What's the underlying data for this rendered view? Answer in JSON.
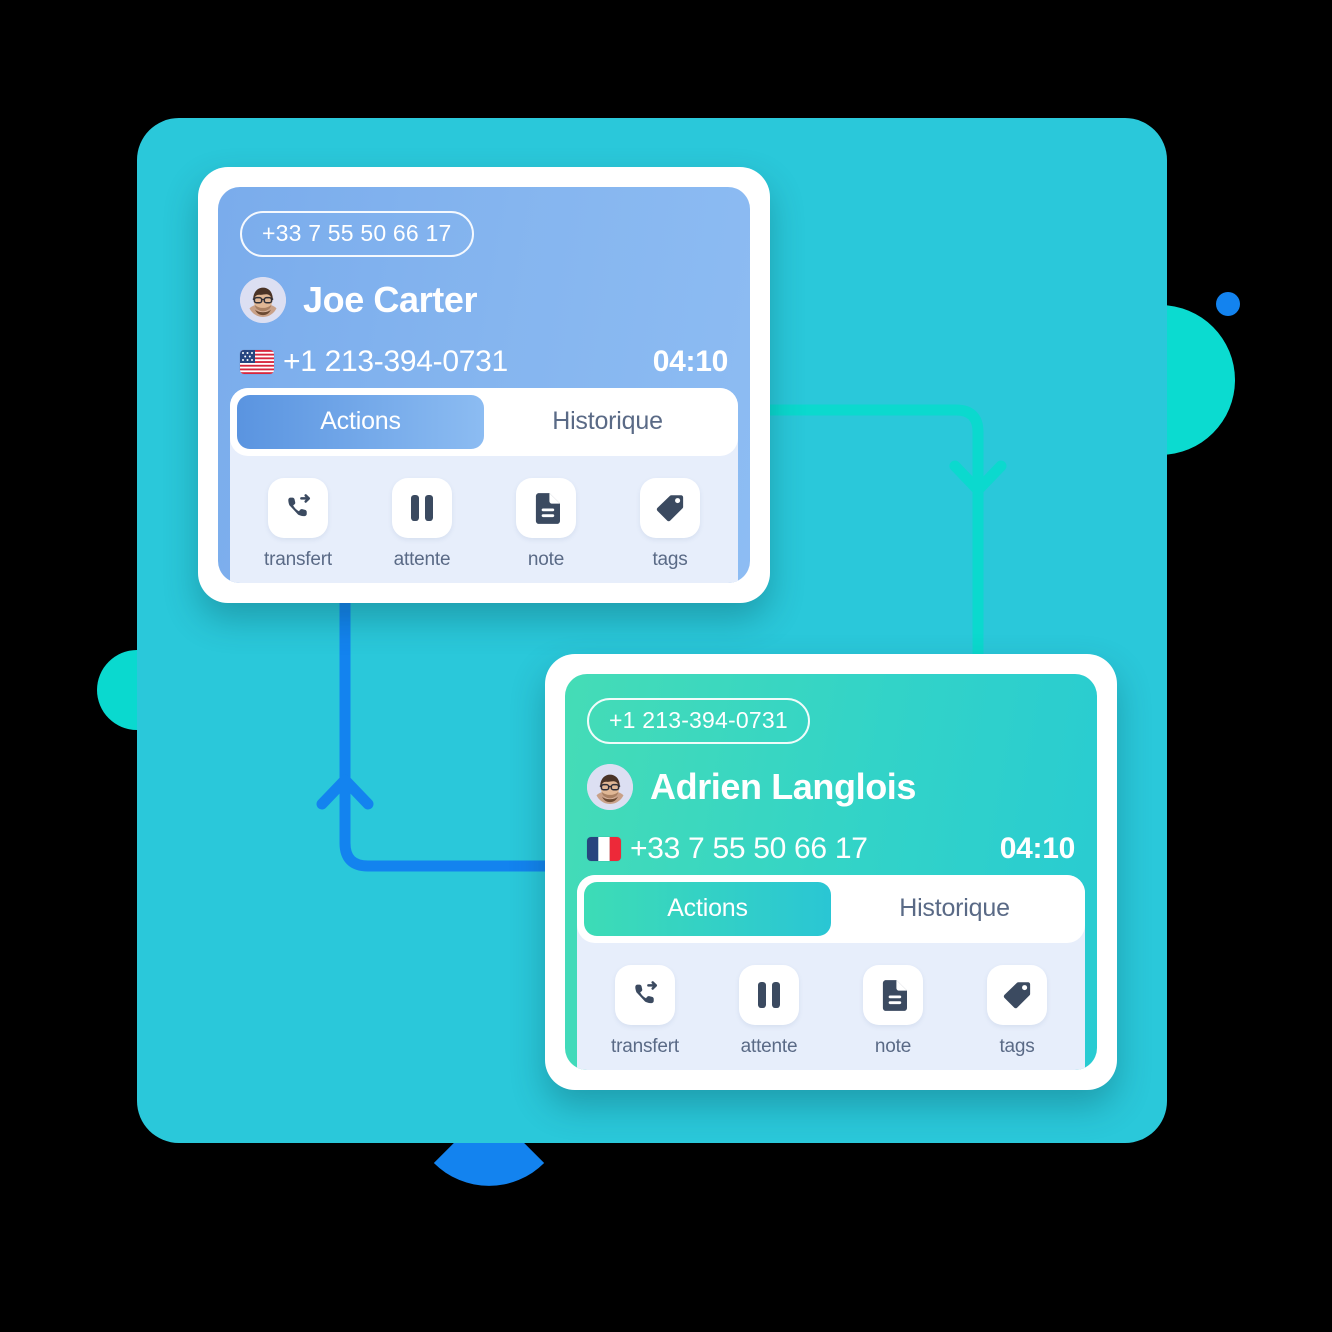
{
  "theme": {
    "backdrop_color": "#2AC8DA",
    "card1_accent": "#85B5EF",
    "card2_accent": "#32D3C8",
    "connector_blue": "#1383EF",
    "connector_teal": "#0BD9CE",
    "panel_bg": "#E7EEFB",
    "icon_color": "#3B4A60",
    "label_color": "#5A6A86"
  },
  "decorations": [
    {
      "name": "circle-teal-right",
      "color": "#0BDBD0"
    },
    {
      "name": "circle-blue-small",
      "color": "#1383EF"
    },
    {
      "name": "circle-teal-left",
      "color": "#0AD9CF"
    },
    {
      "name": "leaf-blue",
      "color": "#1383EF"
    }
  ],
  "connectors": [
    {
      "name": "teal-arrow-down",
      "from": "card-joe-right",
      "to": "card-adrien-top",
      "color": "#0BD9CE",
      "direction": "down"
    },
    {
      "name": "blue-arrow-up",
      "from": "card-adrien-left",
      "to": "card-joe-bottom",
      "color": "#1383EF",
      "direction": "up"
    }
  ],
  "cards": [
    {
      "id": "joe",
      "caller_line": "+33 7 55 50 66 17",
      "contact_name": "Joe Carter",
      "avatar_icon": "avatar-photo",
      "flag_icon": "flag-us",
      "flag_country": "US",
      "phone_number": "+1 213-394-0731",
      "timer": "04:10",
      "tabs": [
        {
          "label": "Actions",
          "active": true
        },
        {
          "label": "Historique",
          "active": false
        }
      ],
      "actions": [
        {
          "icon": "phone-transfer-icon",
          "label": "transfert"
        },
        {
          "icon": "pause-icon",
          "label": "attente"
        },
        {
          "icon": "document-icon",
          "label": "note"
        },
        {
          "icon": "tag-icon",
          "label": "tags"
        }
      ]
    },
    {
      "id": "adrien",
      "caller_line": "+1 213-394-0731",
      "contact_name": "Adrien Langlois",
      "avatar_icon": "avatar-photo",
      "flag_icon": "flag-fr",
      "flag_country": "FR",
      "phone_number": "+33 7 55 50 66 17",
      "timer": "04:10",
      "tabs": [
        {
          "label": "Actions",
          "active": true
        },
        {
          "label": "Historique",
          "active": false
        }
      ],
      "actions": [
        {
          "icon": "phone-transfer-icon",
          "label": "transfert"
        },
        {
          "icon": "pause-icon",
          "label": "attente"
        },
        {
          "icon": "document-icon",
          "label": "note"
        },
        {
          "icon": "tag-icon",
          "label": "tags"
        }
      ]
    }
  ]
}
